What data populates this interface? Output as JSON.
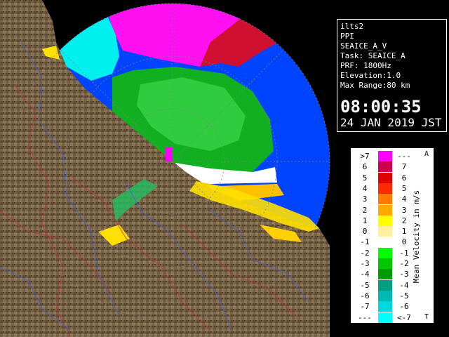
{
  "info": {
    "site": "ilts2",
    "mode": "PPI",
    "product": "SEAICE_A_V",
    "task": "Task: SEAICE_A",
    "prf": "PRF: 1800Hz",
    "elevation": "Elevation:1.0",
    "max_range": "Max Range:80 km",
    "time": "08:00:35",
    "date": "24 JAN 2019 JST"
  },
  "legend": {
    "title": "Mean Velocity in m/s",
    "corner_top": "A",
    "corner_bottom": "T",
    "rows": [
      {
        "left": ">7",
        "right": "---",
        "color": "#ff00ff"
      },
      {
        "left": "6",
        "right": "7",
        "color": "#d00050"
      },
      {
        "left": "5",
        "right": "6",
        "color": "#e00000"
      },
      {
        "left": "4",
        "right": "5",
        "color": "#ff2a00"
      },
      {
        "left": "3",
        "right": "4",
        "color": "#ff7800"
      },
      {
        "left": "2",
        "right": "3",
        "color": "#ffa800"
      },
      {
        "left": "1",
        "right": "2",
        "color": "#ffff00"
      },
      {
        "left": "0",
        "right": "1",
        "color": "#fff0a0"
      },
      {
        "left": "-1",
        "right": "0",
        "color": "#ffffff"
      },
      {
        "left": "-2",
        "right": "-1",
        "color": "#00ff00"
      },
      {
        "left": "-3",
        "right": "-2",
        "color": "#00c800"
      },
      {
        "left": "-4",
        "right": "-3",
        "color": "#009c00"
      },
      {
        "left": "-5",
        "right": "-4",
        "color": "#00a080"
      },
      {
        "left": "-6",
        "right": "-5",
        "color": "#00b8b8"
      },
      {
        "left": "-7",
        "right": "-6",
        "color": "#00d8e0"
      },
      {
        "left": "---",
        "right": "<-7",
        "color": "#00ffff"
      }
    ]
  },
  "colors": {
    "background": "#000000",
    "range_disc": "#0040ff",
    "land": "#7a6448",
    "approaching": "#00c000",
    "receding": "#ff00ff"
  }
}
